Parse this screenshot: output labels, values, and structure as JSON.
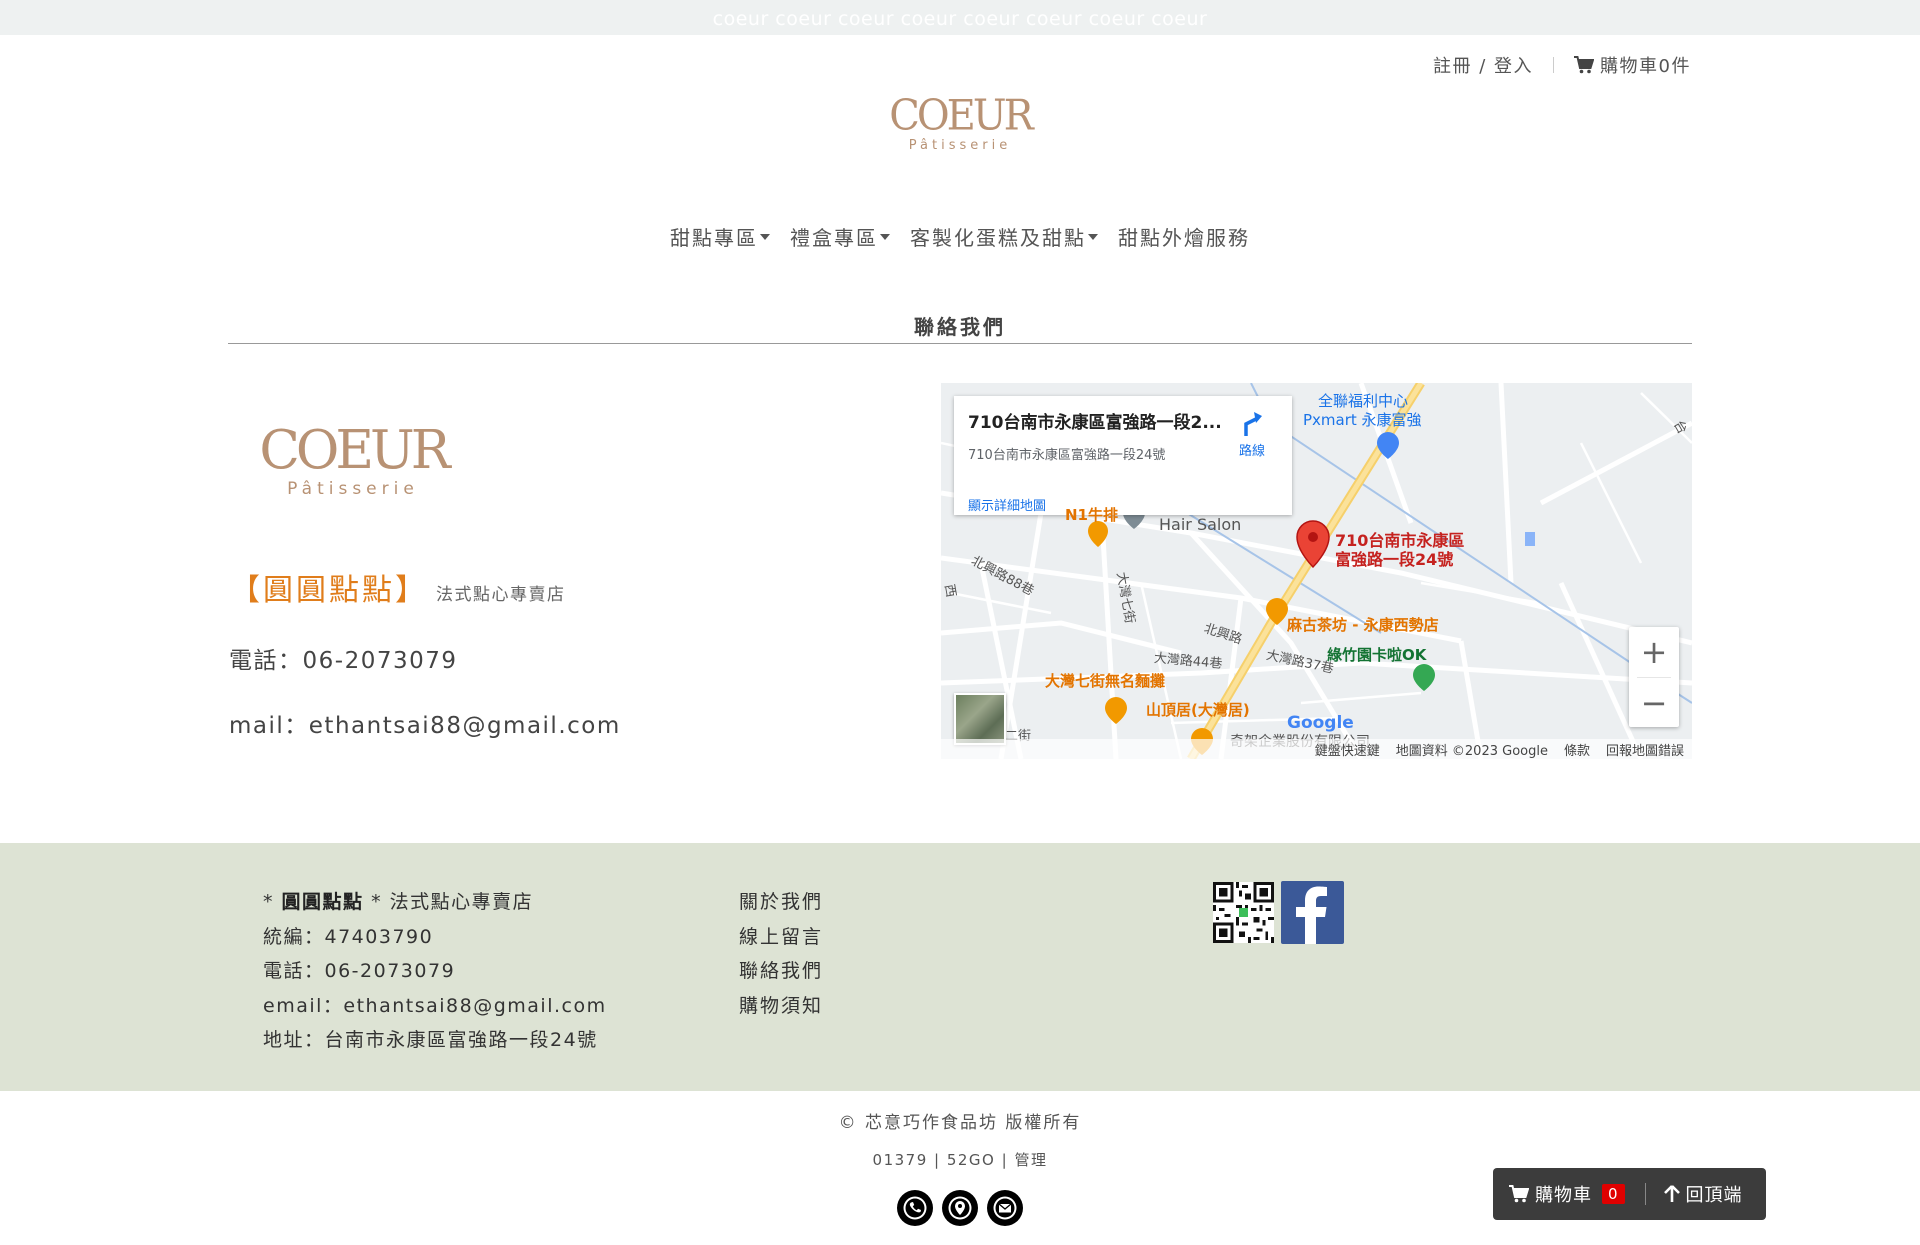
{
  "topbar": {
    "text": "coeur coeur coeur coeur coeur coeur coeur coeur"
  },
  "header": {
    "login_label": "註冊 / 登入",
    "cart_label": "購物車0件",
    "logo_word": "COEUR",
    "logo_sub": "Pâtisserie"
  },
  "nav": {
    "items": [
      {
        "label": "甜點專區"
      },
      {
        "label": "禮盒專區"
      },
      {
        "label": "客製化蛋糕及甜點"
      },
      {
        "label": "甜點外燴服務"
      }
    ]
  },
  "page": {
    "title": "聯絡我們"
  },
  "contact": {
    "shop_name": "【圓圓點點】",
    "shop_tag": "法式點心專賣店",
    "phone": "電話：06-2073079",
    "mail": "mail：ethantsai88@gmail.com"
  },
  "map": {
    "card_title": "710台南市永康區富強路一段2...",
    "card_address": "710台南市永康區富強路一段24號",
    "card_link": "顯示詳細地圖",
    "directions": "路線",
    "pin_label_1": "710台南市永康區",
    "pin_label_2": "富強路一段24號",
    "poi_pxmart_1": "全聯福利中心",
    "poi_pxmart_2": "Pxmart 永康富強",
    "poi_hair": "Hair Salon",
    "poi_niu": "N1牛排",
    "poi_magu": "麻古茶坊 - 永康西勢店",
    "poi_green": "綠竹園卡啦OK",
    "poi_noodle": "大灣七街無名麵攤",
    "poi_shanding": "山頂居(大灣居)",
    "poi_qijia": "奇架企業股份有限公司",
    "street_beixing88": "北興路88巷",
    "street_beixing": "北興路",
    "street_dawan7": "大灣七街",
    "street_dawan44": "大灣路44巷",
    "street_dawan37": "大灣路37巷",
    "street_xi": "西",
    "street_er": "二街",
    "street_te": "台",
    "google": "Google",
    "attrib_keys": "鍵盤快速鍵",
    "attrib_data": "地圖資料 ©2023 Google",
    "attrib_terms": "條款",
    "attrib_report": "回報地圖錯誤",
    "zoom_in": "+",
    "zoom_out": "−"
  },
  "footer": {
    "company_bold": "圓圓點點",
    "company_tag": "法式點心專賣店",
    "tax_id": "統編：47403790",
    "phone": "電話：06-2073079",
    "email": "email：ethantsai88@gmail.com",
    "address": "地址：台南市永康區富強路一段24號",
    "links": [
      {
        "label": "關於我們"
      },
      {
        "label": "線上留言"
      },
      {
        "label": "聯絡我們"
      },
      {
        "label": "購物須知"
      }
    ],
    "copyright": "© 芯意巧作食品坊 版權所有",
    "credits": "01379 | 52GO | 管理"
  },
  "floatbar": {
    "cart_label": "購物車",
    "cart_count": "0",
    "top_label": "回頂端"
  },
  "colors": {
    "brand": "#b89274",
    "accent_orange": "#e07d1b",
    "footer_bg": "#dde3d4",
    "facebook": "#3b5998",
    "badge_red": "#e00000"
  },
  "icons": [
    "cart-icon",
    "caret-down-icon",
    "directions-icon",
    "map-pin-icon",
    "fork-knife-icon",
    "store-icon",
    "tree-icon",
    "qr-code-icon",
    "facebook-icon",
    "phone-icon",
    "location-icon",
    "mail-icon",
    "arrow-up-icon"
  ]
}
